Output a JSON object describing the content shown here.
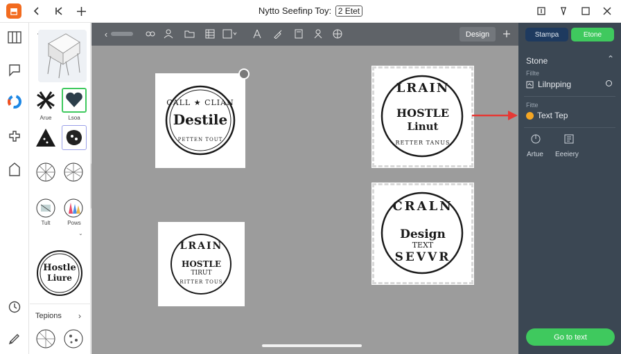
{
  "window": {
    "title": "Nytto Seefinp Toy:",
    "title_badge": "2 Etet"
  },
  "icons": {
    "app_logo": "app-logo",
    "back": "chevron-left",
    "first": "skip-back",
    "move": "move-cross",
    "rail": [
      "library",
      "comment",
      "brand-swirl",
      "puzzle",
      "document",
      "clock",
      "pen"
    ],
    "toolbar": [
      "undo-arrow",
      "link",
      "person",
      "folder",
      "grid",
      "ruler",
      "compass",
      "brush",
      "frame",
      "user",
      "world"
    ]
  },
  "toolbar": {
    "design_label": "Design"
  },
  "asset_panel": {
    "items": [
      {
        "label": "Arue"
      },
      {
        "label": "Lsoa"
      },
      {
        "label": ""
      },
      {
        "label": ""
      },
      {
        "label": ""
      },
      {
        "label": ""
      },
      {
        "label": "Tult"
      },
      {
        "label": "Pows"
      }
    ],
    "feature_stamp": {
      "line1": "Hostle",
      "line2": "Liure"
    },
    "section_title": "Tepions"
  },
  "canvas": {
    "stamps": [
      {
        "top_text": "CALL ★ CLIAN",
        "main": "Destile",
        "sub": "",
        "bottom_text": "PETTEN TOUT"
      },
      {
        "top_text": "LRAIN",
        "main": "HOSTLE",
        "sub": "Linut",
        "bottom_text": "RETTER TANUS"
      },
      {
        "top_text": "LRAIN",
        "main": "HOSTLE",
        "sub": "TIRUT",
        "bottom_text": "RITTER TOUS"
      },
      {
        "top_text": "CRALN",
        "main": "Design",
        "sub": "TEXT",
        "bottom_text": "SEVVR"
      }
    ]
  },
  "right_panel": {
    "button_secondary": "Stampa",
    "button_primary": "Etone",
    "section_title": "Stone",
    "row1_label": "Fillte",
    "row1_value": "Lilnpping",
    "row2_label": "Fitte",
    "row2_value": "Text Tep",
    "actions": [
      {
        "label": "Artue"
      },
      {
        "label": "Eeeiery"
      }
    ],
    "cta": "Go to text"
  },
  "colors": {
    "accent_green": "#3fc95e",
    "arrow_red": "#e53935",
    "panel_dark": "#3b4753",
    "logo_orange": "#f26b1f"
  }
}
